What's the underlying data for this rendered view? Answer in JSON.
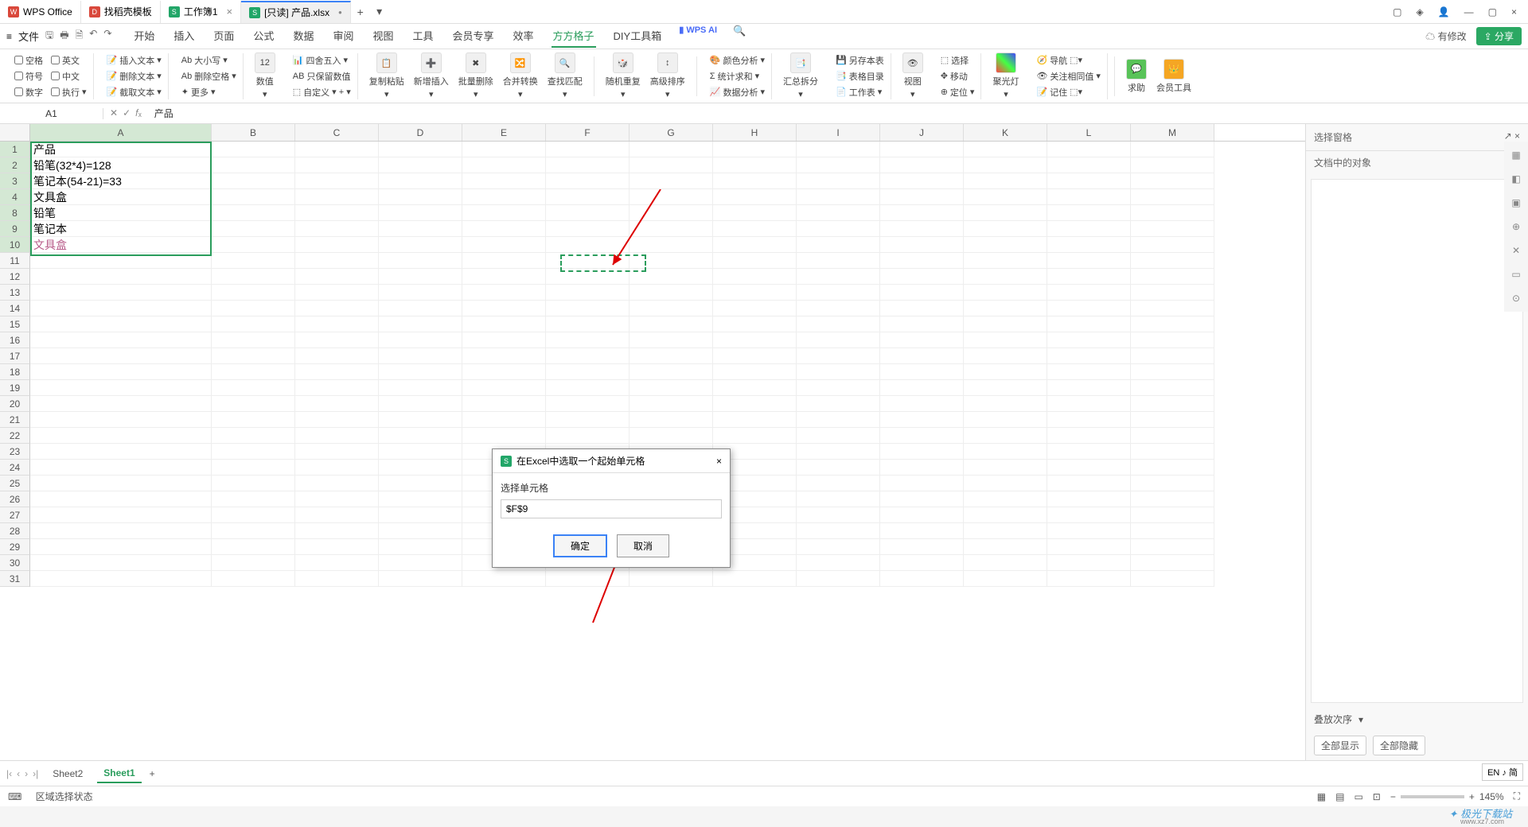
{
  "tabs": {
    "t1": "WPS Office",
    "t2": "找稻壳模板",
    "t3": "工作簿1",
    "t4": "[只读] 产品.xlsx"
  },
  "menu": {
    "file": "文件",
    "start": "开始",
    "insert": "插入",
    "page": "页面",
    "formula": "公式",
    "data": "数据",
    "review": "审阅",
    "view": "视图",
    "tool": "工具",
    "vip": "会员专享",
    "eff": "效率",
    "square": "方方格子",
    "diy": "DIY工具箱",
    "wpsai": "WPS AI",
    "mod": "有修改",
    "share": "分享"
  },
  "ribbon": {
    "chk": {
      "blank": "空格",
      "en": "英文",
      "sym": "符号",
      "cn": "中文",
      "num": "数字",
      "exec": "执行"
    },
    "tools": {
      "instext": "插入文本",
      "upper": "大小写",
      "deltext": "删除文本",
      "delspace": "删除空格",
      "captext": "截取文本",
      "more": "更多",
      "count": "数值",
      "round": "四舍五入",
      "keep": "只保留数值",
      "custom": "自定义",
      "paste": "复制粘贴",
      "newins": "新增插入",
      "batchdel": "批量删除",
      "merge": "合并转换",
      "findmatch": "查找匹配",
      "random": "随机重复",
      "advsort": "高级排序",
      "color": "颜色分析",
      "stat": "统计求和",
      "analyze": "数据分析",
      "split": "汇总拆分",
      "savesheet": "另存本表",
      "catalog": "表格目录",
      "worksheet": "工作表",
      "vision": "视图",
      "select": "选择",
      "move": "移动",
      "locate": "定位",
      "light": "聚光灯",
      "nav": "导航",
      "watchval": "关注相同值",
      "remember": "记住",
      "help": "求助",
      "member": "会员工具"
    }
  },
  "namebox": "A1",
  "formula": "产品",
  "columns": [
    "A",
    "B",
    "C",
    "D",
    "E",
    "F",
    "G",
    "H",
    "I",
    "J",
    "K",
    "L",
    "M"
  ],
  "rows_shown": [
    "1",
    "2",
    "3",
    "4",
    "8",
    "9",
    "10",
    "11",
    "12",
    "13",
    "14",
    "15",
    "16",
    "17",
    "18",
    "19",
    "20",
    "21",
    "22",
    "23",
    "24",
    "25",
    "26",
    "27",
    "28",
    "29",
    "30",
    "31"
  ],
  "cells": {
    "A1": "产品",
    "A2": "铅笔(32*4)=128",
    "A3": "笔记本(54-21)=33",
    "A4": "文具盒",
    "A8": "铅笔",
    "A9": "笔记本",
    "A10": "文具盒"
  },
  "sidepanel": {
    "title": "选择窗格",
    "sub": "文档中的对象",
    "stack": "叠放次序",
    "showall": "全部显示",
    "hideall": "全部隐藏"
  },
  "dialog": {
    "title": "在Excel中选取一个起始单元格",
    "label": "选择单元格",
    "value": "$F$9",
    "ok": "确定",
    "cancel": "取消"
  },
  "sheets": {
    "s1": "Sheet2",
    "s2": "Sheet1"
  },
  "status": {
    "left": "区域选择状态",
    "zoom": "145%"
  },
  "lang": "EN ♪ 简",
  "watermark": "极光下载站",
  "wm_url": "www.xz7.com"
}
